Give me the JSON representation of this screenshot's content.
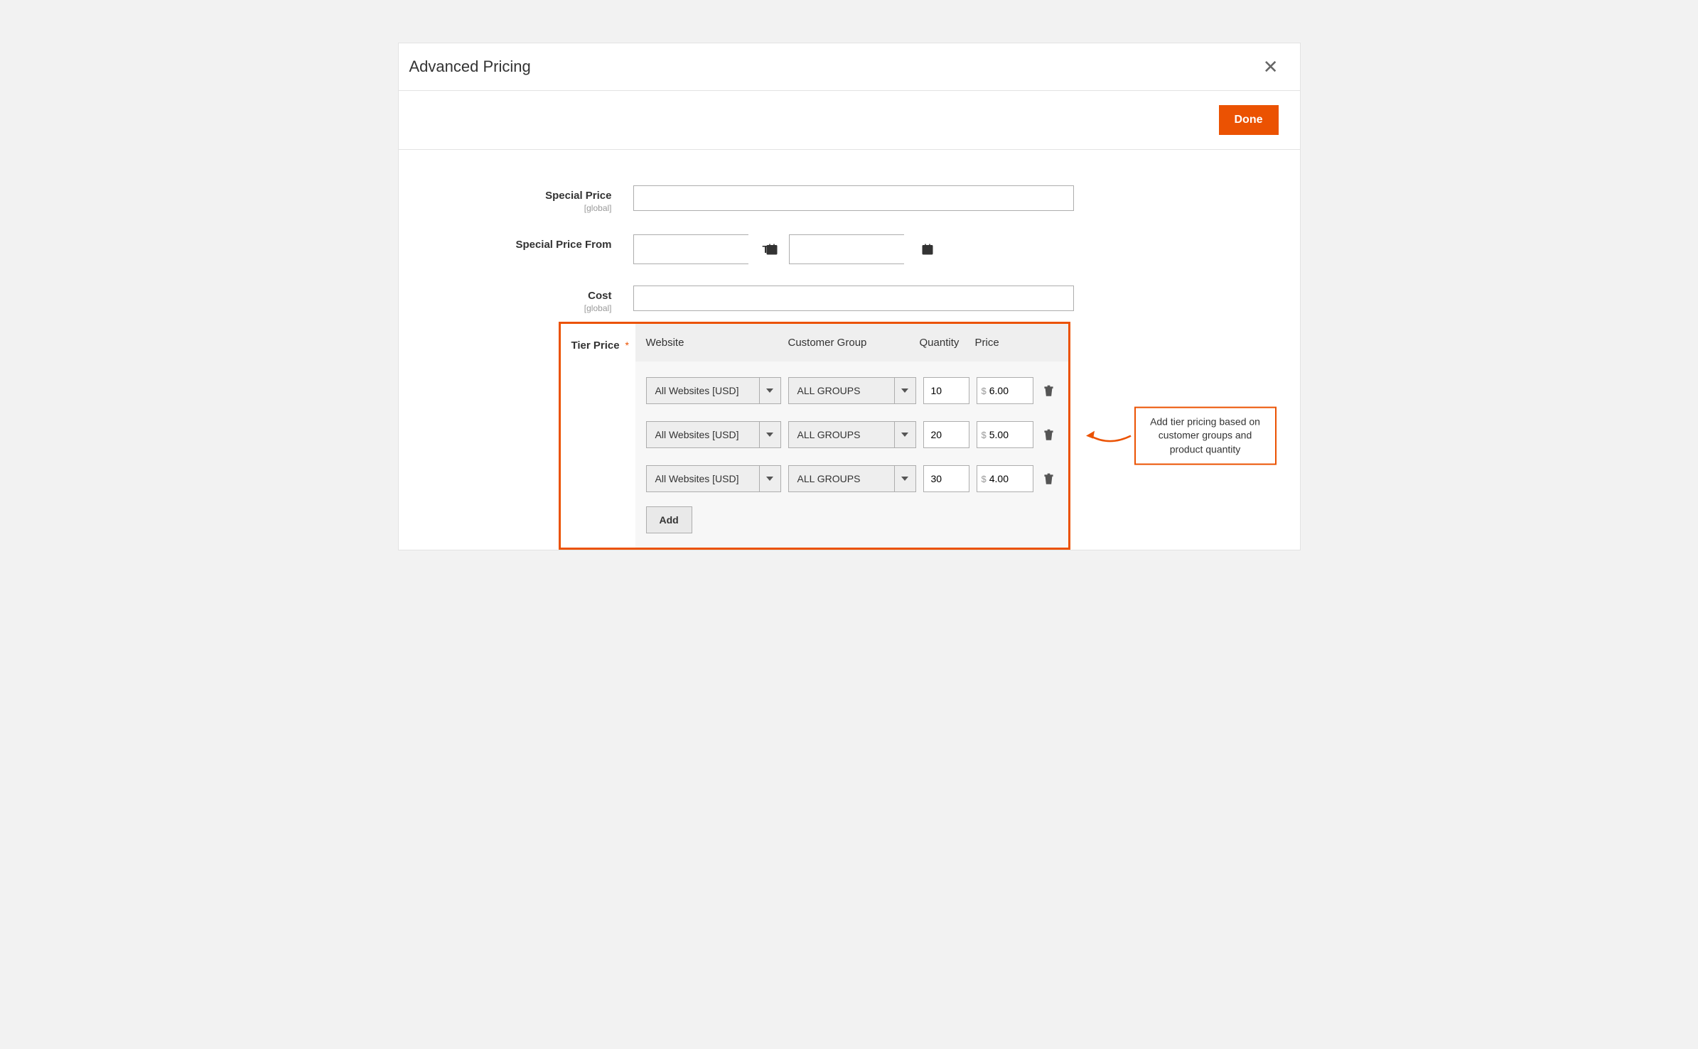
{
  "modal": {
    "title": "Advanced Pricing",
    "done_label": "Done"
  },
  "special_price": {
    "label": "Special Price",
    "scope": "[global]",
    "currency": "$",
    "value": ""
  },
  "special_price_from": {
    "label": "Special Price From",
    "to_label": "To",
    "from_value": "",
    "to_value": ""
  },
  "cost": {
    "label": "Cost",
    "scope": "[global]",
    "currency": "$",
    "value": ""
  },
  "tier_price": {
    "label": "Tier Price",
    "required_mark": "*",
    "headers": {
      "website": "Website",
      "group": "Customer Group",
      "qty": "Quantity",
      "price": "Price"
    },
    "rows": [
      {
        "website": "All Websites [USD]",
        "group": "ALL GROUPS",
        "qty": "10",
        "price": "6.00",
        "currency": "$"
      },
      {
        "website": "All Websites [USD]",
        "group": "ALL GROUPS",
        "qty": "20",
        "price": "5.00",
        "currency": "$"
      },
      {
        "website": "All Websites [USD]",
        "group": "ALL GROUPS",
        "qty": "30",
        "price": "4.00",
        "currency": "$"
      }
    ],
    "add_label": "Add"
  },
  "annotation": {
    "text": "Add tier pricing based on customer groups and product quantity"
  }
}
